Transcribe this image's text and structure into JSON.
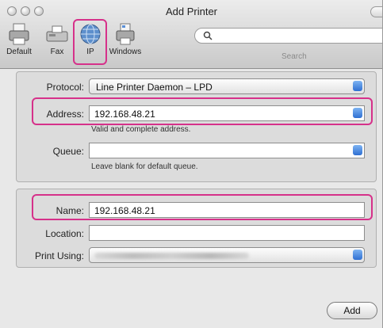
{
  "window": {
    "title": "Add Printer"
  },
  "toolbar": {
    "items": [
      {
        "label": "Default",
        "icon": "default-printer-icon"
      },
      {
        "label": "Fax",
        "icon": "fax-icon"
      },
      {
        "label": "IP",
        "icon": "globe-icon",
        "selected": true
      },
      {
        "label": "Windows",
        "icon": "windows-printer-icon"
      }
    ],
    "search_label": "Search",
    "search_value": ""
  },
  "connection": {
    "protocol_label": "Protocol:",
    "protocol_value": "Line Printer Daemon – LPD",
    "address_label": "Address:",
    "address_value": "192.168.48.21",
    "address_hint": "Valid and complete address.",
    "queue_label": "Queue:",
    "queue_value": "",
    "queue_hint": "Leave blank for default queue."
  },
  "printer": {
    "name_label": "Name:",
    "name_value": "192.168.48.21",
    "location_label": "Location:",
    "location_value": "",
    "print_using_label": "Print Using:"
  },
  "actions": {
    "add_label": "Add"
  },
  "colors": {
    "highlight": "#d6318a",
    "accent": "#2f6fd2"
  }
}
